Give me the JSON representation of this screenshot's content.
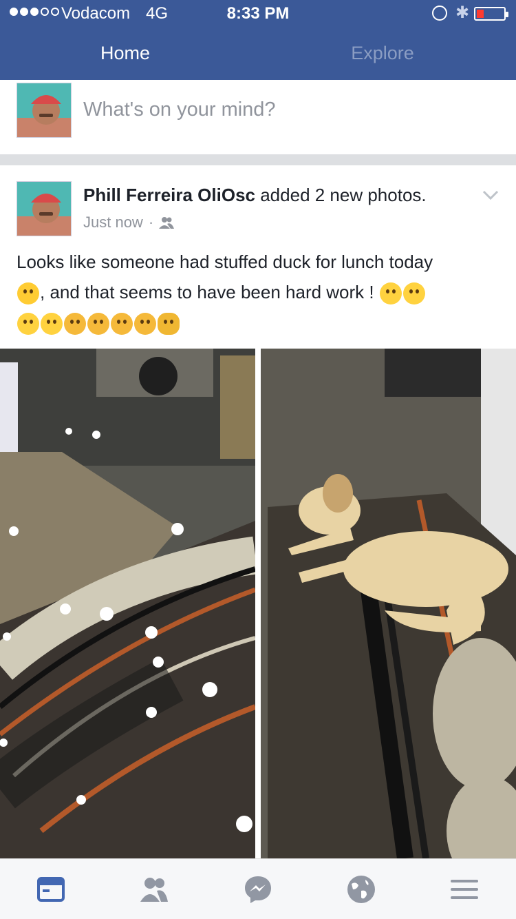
{
  "status_bar": {
    "carrier": "Vodacom",
    "network": "4G",
    "time": "8:33 PM",
    "signal_bars": 3,
    "signal_total": 5,
    "battery_level": 0.15
  },
  "tabs": [
    {
      "label": "Home",
      "active": true
    },
    {
      "label": "Explore",
      "active": false
    }
  ],
  "composer": {
    "placeholder": "What's on your mind?"
  },
  "post": {
    "author": "Phill Ferreira OliOsc",
    "action": " added 2 new photos.",
    "timestamp": "Just now",
    "separator": "·",
    "audience_icon": "friends-icon",
    "text_line1": "Looks like someone had stuffed duck for lunch today",
    "text_line2": ", and that seems to have been hard work !",
    "emojis_line2": [
      "face-with-tears-of-joy",
      "grinning-face",
      "grinning-face"
    ],
    "emojis_line3": [
      "grinning-face",
      "grinning-face",
      "thinking-face",
      "thinking-face",
      "thinking-face",
      "thinking-face",
      "weary-cat-face"
    ],
    "photo_count": 2
  },
  "bottom_nav": [
    {
      "icon": "news-feed-icon",
      "active": true
    },
    {
      "icon": "friend-requests-icon",
      "active": false
    },
    {
      "icon": "messenger-icon",
      "active": false
    },
    {
      "icon": "notifications-globe-icon",
      "active": false
    },
    {
      "icon": "menu-icon",
      "active": false
    }
  ],
  "colors": {
    "brand": "#3b5998",
    "active_nav": "#4267b2",
    "inactive_nav": "#9197a3"
  }
}
